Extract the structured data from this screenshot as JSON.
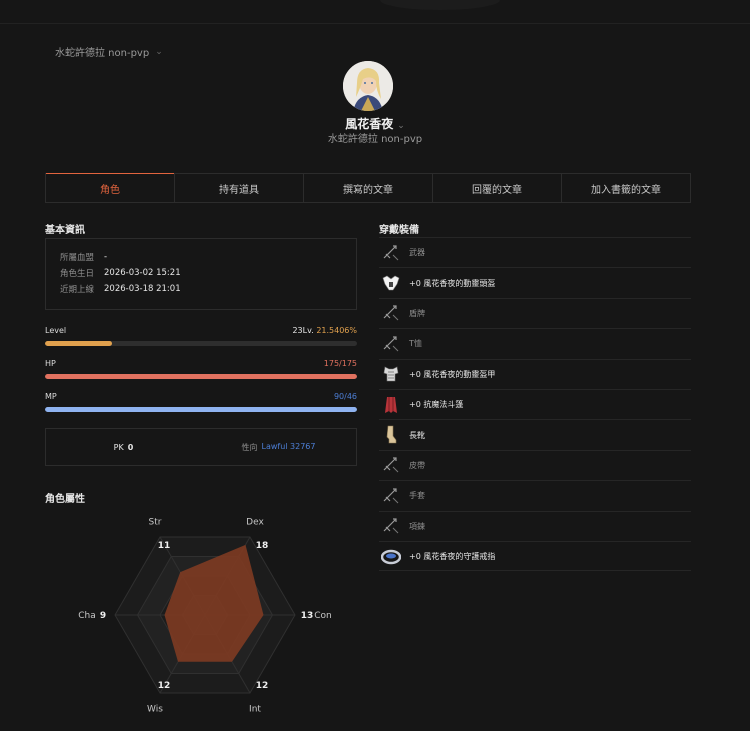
{
  "server_selector": {
    "label": "水蛇許德拉 non-pvp"
  },
  "profile": {
    "name": "風花香夜",
    "server": "水蛇許德拉 non-pvp"
  },
  "tabs": [
    {
      "label": "角色",
      "active": true
    },
    {
      "label": "持有道具",
      "active": false
    },
    {
      "label": "撰寫的文章",
      "active": false
    },
    {
      "label": "回覆的文章",
      "active": false
    },
    {
      "label": "加入書籤的文章",
      "active": false
    }
  ],
  "basic_info": {
    "title": "基本資訊",
    "rows": [
      {
        "key": "所屬血盟",
        "value": "-"
      },
      {
        "key": "角色生日",
        "value": "2026-03-02 15:21"
      },
      {
        "key": "近期上線",
        "value": "2026-03-18 21:01"
      }
    ]
  },
  "stats": {
    "level": {
      "label": "Level",
      "value": "23Lv.",
      "percent_text": "21.5406%",
      "fill": 0.215406
    },
    "hp": {
      "label": "HP",
      "value": "175/175",
      "fill": 1.0
    },
    "mp": {
      "label": "MP",
      "value": "90/46",
      "fill": 1.0
    }
  },
  "pk": {
    "pk_label": "PK",
    "pk_value": "0",
    "align_label": "性向",
    "align_value": "Lawful 32767"
  },
  "attributes": {
    "title": "角色屬性",
    "axes": [
      {
        "name": "Str",
        "value": 11
      },
      {
        "name": "Dex",
        "value": 18
      },
      {
        "name": "Con",
        "value": 13
      },
      {
        "name": "Int",
        "value": 12
      },
      {
        "name": "Wis",
        "value": 12
      },
      {
        "name": "Cha",
        "value": 9
      }
    ]
  },
  "equipment": {
    "title": "穿戴裝備",
    "items": [
      {
        "name": "武器",
        "icon": "weapon-slot-icon",
        "equipped": false
      },
      {
        "name": "+0 風花香夜的動靈頭盔",
        "icon": "helmet-icon",
        "equipped": true
      },
      {
        "name": "盾牌",
        "icon": "shield-slot-icon",
        "equipped": false
      },
      {
        "name": "T恤",
        "icon": "tshirt-slot-icon",
        "equipped": false
      },
      {
        "name": "+0 風花香夜的動靈盔甲",
        "icon": "armor-icon",
        "equipped": true
      },
      {
        "name": "+0 抗魔法斗篷",
        "icon": "cloak-icon",
        "equipped": true
      },
      {
        "name": "長靴",
        "icon": "boots-icon",
        "equipped": true
      },
      {
        "name": "皮帶",
        "icon": "belt-slot-icon",
        "equipped": false
      },
      {
        "name": "手套",
        "icon": "gloves-slot-icon",
        "equipped": false
      },
      {
        "name": "項鍊",
        "icon": "necklace-slot-icon",
        "equipped": false
      },
      {
        "name": "+0 風花香夜的守護戒指",
        "icon": "ring-icon",
        "equipped": true
      }
    ]
  },
  "colors": {
    "accent": "#e2643e",
    "level_bar": "#e1a14e",
    "hp_bar": "#e1715f",
    "mp_bar": "#8fb3f0",
    "link_blue": "#4d7fd6",
    "radar_fill": "#7e3b22"
  }
}
